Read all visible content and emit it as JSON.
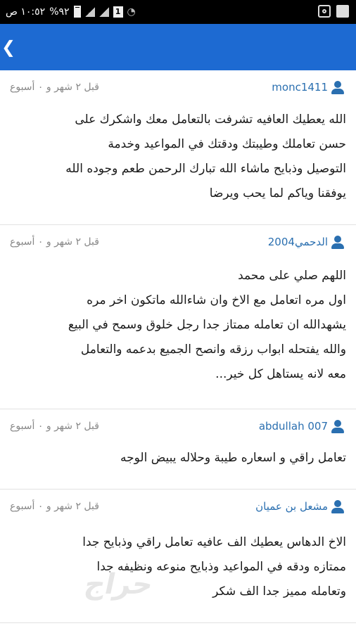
{
  "status_bar": {
    "time": "١٠:٥٢ ص",
    "battery": "%٩٢",
    "sim": "1"
  },
  "app_bar": {
    "back_glyph": "❮"
  },
  "comments": [
    {
      "user": "monc1411",
      "time": "قبل ٢ شهر و ٠ أسبوع",
      "lines": [
        "الله يعطيك العافيه تشرفت بالتعامل معك واشكرك على",
        "حسن تعاملك وطيبتك ودقتك في المواعيد وخدمة",
        "التوصيل وذبايح ماشاء الله تبارك الرحمن طعم وجوده الله",
        "يوفقنا وياكم لما يحب ويرضا"
      ]
    },
    {
      "user": "الدحمي2004",
      "time": "قبل ٢ شهر و ٠ أسبوع",
      "lines": [
        "اللهم صلي على محمد",
        "اول مره اتعامل مع الاخ وان شاءالله ماتكون اخر مره",
        "يشهدالله ان تعامله ممتاز جدا رجل خلوق وسمح في البيع",
        "والله يفتحله ابواب رزقه وانصح الجميع بدعمه والتعامل",
        "معه لانه يستاهل كل خير..."
      ]
    },
    {
      "user": "abdullah 007",
      "time": "قبل ٢ شهر و ٠ أسبوع",
      "lines": [
        "تعامل راقي و اسعاره طيبة وحلاله يبيض الوجه"
      ]
    },
    {
      "user": "مشعل بن عميان",
      "time": "قبل ٢ شهر و ٠ أسبوع",
      "lines": [
        "الاخ الدهاس يعطيك الف عافيه تعامل راقي وذبايح جدا",
        "ممتازه ودقه في المواعيد وذبايح منوعه ونظيفه جدا",
        "وتعامله مميز جدا الف شكر"
      ]
    }
  ],
  "colors": {
    "app_bar": "#1d6ad2",
    "username": "#2a6fb0",
    "timestamp": "#888888"
  }
}
